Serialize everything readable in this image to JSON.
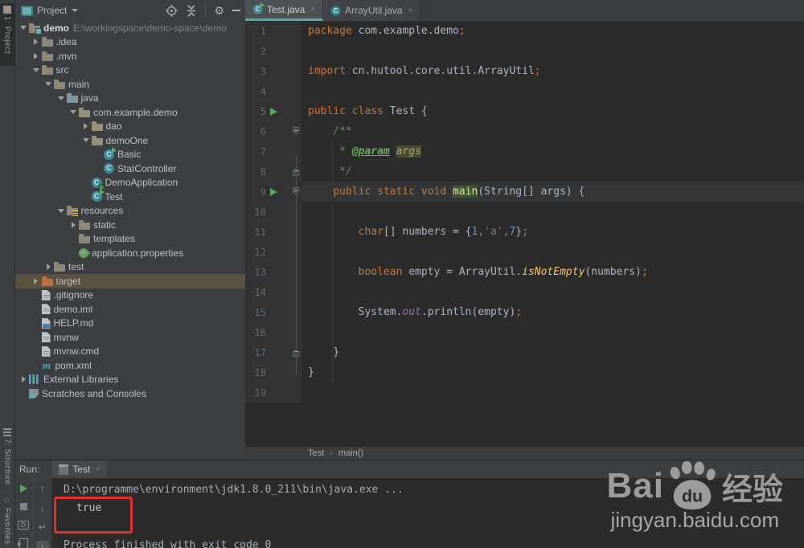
{
  "colors": {
    "accent_teal": "#4DAEA9",
    "annotation_red": "#E0312D",
    "selected_row": "#5A5140",
    "keyword_orange": "#CC7832",
    "editor_bg": "#2B2B2B",
    "panel_bg": "#3C3F41"
  },
  "stripe": {
    "project_tab": "1: Project",
    "structure_tab": "7: Structure",
    "favorites_tab": "Favorites"
  },
  "project_panel": {
    "title": "Project",
    "toolbar_icons": [
      "locate-icon",
      "collapse-all-icon",
      "gear-icon",
      "hide-icon"
    ],
    "tree": [
      {
        "label": "demo",
        "suffix": "E:\\workingspace\\demo-space\\demo",
        "level": 0,
        "arrow": "open",
        "icon": "folder-mod",
        "bold": true
      },
      {
        "label": ".idea",
        "level": 1,
        "arrow": "closed",
        "icon": "folder"
      },
      {
        "label": ".mvn",
        "level": 1,
        "arrow": "closed",
        "icon": "folder"
      },
      {
        "label": "src",
        "level": 1,
        "arrow": "open",
        "icon": "folder"
      },
      {
        "label": "main",
        "level": 2,
        "arrow": "open",
        "icon": "folder"
      },
      {
        "label": "java",
        "level": 3,
        "arrow": "open",
        "icon": "folder-src"
      },
      {
        "label": "com.example.demo",
        "level": 4,
        "arrow": "open",
        "icon": "package"
      },
      {
        "label": "dao",
        "level": 5,
        "arrow": "closed",
        "icon": "package"
      },
      {
        "label": "demoOne",
        "level": 5,
        "arrow": "open",
        "icon": "package"
      },
      {
        "label": "Basic",
        "level": 6,
        "arrow": null,
        "icon": "class-run"
      },
      {
        "label": "StatController",
        "level": 6,
        "arrow": null,
        "icon": "class"
      },
      {
        "label": "DemoApplication",
        "level": 5,
        "arrow": null,
        "icon": "class-boot"
      },
      {
        "label": "Test",
        "level": 5,
        "arrow": null,
        "icon": "class-run"
      },
      {
        "label": "resources",
        "level": 3,
        "arrow": "open",
        "icon": "folder-res"
      },
      {
        "label": "static",
        "level": 4,
        "arrow": "closed",
        "icon": "folder"
      },
      {
        "label": "templates",
        "level": 4,
        "arrow": null,
        "icon": "folder"
      },
      {
        "label": "application.properties",
        "level": 4,
        "arrow": null,
        "icon": "props"
      },
      {
        "label": "test",
        "level": 2,
        "arrow": "closed",
        "icon": "folder"
      },
      {
        "label": "target",
        "level": 1,
        "arrow": "closed",
        "icon": "folder-exc",
        "selected": true
      },
      {
        "label": ".gitignore",
        "level": 1,
        "arrow": null,
        "icon": "file"
      },
      {
        "label": "demo.iml",
        "level": 1,
        "arrow": null,
        "icon": "file"
      },
      {
        "label": "HELP.md",
        "level": 1,
        "arrow": null,
        "icon": "file-md"
      },
      {
        "label": "mvnw",
        "level": 1,
        "arrow": null,
        "icon": "file"
      },
      {
        "label": "mvnw.cmd",
        "level": 1,
        "arrow": null,
        "icon": "file"
      },
      {
        "label": "pom.xml",
        "level": 1,
        "arrow": null,
        "icon": "maven"
      },
      {
        "label": "External Libraries",
        "level": 0,
        "arrow": "closed",
        "icon": "lib"
      },
      {
        "label": "Scratches and Consoles",
        "level": 0,
        "arrow": null,
        "icon": "scr"
      }
    ]
  },
  "editor": {
    "tabs": [
      {
        "label": "Test.java",
        "icon": "class-run",
        "active": true,
        "close": "×"
      },
      {
        "label": "ArrayUtil.java",
        "icon": "class",
        "active": false,
        "close": "×"
      }
    ],
    "breadcrumbs": [
      "Test",
      "main()"
    ],
    "lines": [
      {
        "n": 1,
        "seg": [
          [
            "kw",
            "package"
          ],
          [
            "pl",
            " com.example.demo"
          ],
          [
            "sm",
            ";"
          ]
        ]
      },
      {
        "n": 2,
        "seg": []
      },
      {
        "n": 3,
        "seg": [
          [
            "kw",
            "import"
          ],
          [
            "pl",
            " cn.hutool.core.util.ArrayUtil"
          ],
          [
            "sm",
            ";"
          ]
        ]
      },
      {
        "n": 4,
        "seg": []
      },
      {
        "n": 5,
        "run": true,
        "seg": [
          [
            "kw",
            "public class"
          ],
          [
            "pl",
            " Test {"
          ]
        ]
      },
      {
        "n": 6,
        "fold": "open",
        "seg": [
          [
            "cm",
            "    /**"
          ]
        ]
      },
      {
        "n": 7,
        "seg": [
          [
            "cm",
            "     * "
          ],
          [
            "tag",
            "@param"
          ],
          [
            "cm",
            " "
          ],
          [
            "arg",
            "args"
          ]
        ]
      },
      {
        "n": 8,
        "fold": "close",
        "seg": [
          [
            "cm",
            "     */"
          ]
        ]
      },
      {
        "n": 9,
        "run": true,
        "fold": "open",
        "hl": true,
        "seg": [
          [
            "kw",
            "    public static void "
          ],
          [
            "main",
            "main"
          ],
          [
            "pl",
            "(String[] args) {"
          ]
        ]
      },
      {
        "n": 10,
        "seg": []
      },
      {
        "n": 11,
        "seg": [
          [
            "kw",
            "        char"
          ],
          [
            "pl",
            "[] numbers = {"
          ],
          [
            "num",
            "1"
          ],
          [
            "sm",
            ","
          ],
          [
            "str",
            "'a'"
          ],
          [
            "sm",
            ","
          ],
          [
            "num",
            "7"
          ],
          [
            "pl",
            "}"
          ],
          [
            "sm",
            ";"
          ]
        ]
      },
      {
        "n": 12,
        "seg": []
      },
      {
        "n": 13,
        "seg": [
          [
            "kw",
            "        boolean"
          ],
          [
            "pl",
            " empty = ArrayUtil."
          ],
          [
            "mth",
            "isNotEmpty"
          ],
          [
            "pl",
            "(numbers)"
          ],
          [
            "sm",
            ";"
          ]
        ]
      },
      {
        "n": 14,
        "seg": []
      },
      {
        "n": 15,
        "seg": [
          [
            "pl",
            "        System."
          ],
          [
            "fld",
            "out"
          ],
          [
            "pl",
            ".println(empty)"
          ],
          [
            "sm",
            ";"
          ]
        ]
      },
      {
        "n": 16,
        "seg": []
      },
      {
        "n": 17,
        "fold": "close",
        "seg": [
          [
            "pl",
            "    }"
          ]
        ]
      },
      {
        "n": 18,
        "seg": [
          [
            "pl",
            "}"
          ]
        ]
      },
      {
        "n": 19,
        "seg": []
      }
    ]
  },
  "run_panel": {
    "label": "Run:",
    "tab": "Test",
    "tab_close": "×",
    "toolbar_col1": [
      "rerun-icon",
      "stop-icon",
      "screenshot-icon",
      "hide-window-icon"
    ],
    "toolbar_col2": [
      "up-stack-icon",
      "down-stack-icon",
      "soft-wrap-icon",
      "scroll-to-end-icon"
    ],
    "console": {
      "command_line": "D:\\programme\\environment\\jdk1.8.0_211\\bin\\java.exe ...",
      "result_line": "true",
      "exit_line": "Process finished with exit code 0"
    }
  },
  "watermark": {
    "bai": "Bai",
    "du": "du",
    "jingyan": "经验",
    "url": "jingyan.baidu.com"
  }
}
